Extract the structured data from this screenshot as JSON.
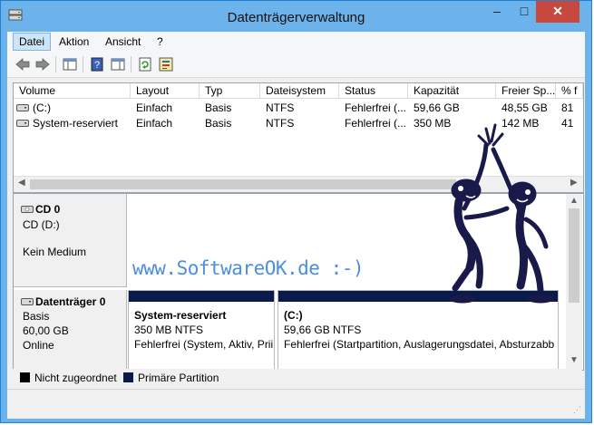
{
  "window": {
    "title": "Datenträgerverwaltung",
    "minimize": "–",
    "maximize": "□",
    "close": "✕"
  },
  "menu": [
    "Datei",
    "Aktion",
    "Ansicht",
    "?"
  ],
  "toolbar": [
    "back-arrow-icon",
    "forward-arrow-icon",
    "console-tree-icon",
    "help-icon",
    "properties-pane-icon",
    "refresh-icon",
    "properties-icon"
  ],
  "columns": [
    "Volume",
    "Layout",
    "Typ",
    "Dateisystem",
    "Status",
    "Kapazität",
    "Freier Sp...",
    "% f"
  ],
  "volumes": [
    {
      "volume": "(C:)",
      "layout": "Einfach",
      "typ": "Basis",
      "fs": "NTFS",
      "status": "Fehlerfrei (...",
      "capacity": "59,66 GB",
      "free": "48,55 GB",
      "pct": "81"
    },
    {
      "volume": "System-reserviert",
      "layout": "Einfach",
      "typ": "Basis",
      "fs": "NTFS",
      "status": "Fehlerfrei (...",
      "capacity": "350 MB",
      "free": "142 MB",
      "pct": "41"
    }
  ],
  "cd": {
    "name": "CD 0",
    "type": "CD (D:)",
    "media": "Kein Medium"
  },
  "disk0": {
    "name": "Datenträger 0",
    "type": "Basis",
    "size": "60,00 GB",
    "state": "Online"
  },
  "partitions": [
    {
      "name": "System-reserviert",
      "size": "350 MB NTFS",
      "status": "Fehlerfrei (System, Aktiv, Prii"
    },
    {
      "name": "(C:)",
      "size": "59,66 GB NTFS",
      "status": "Fehlerfrei (Startpartition, Auslagerungsdatei, Absturzabb"
    }
  ],
  "legend": [
    {
      "label": "Nicht zugeordnet",
      "color": "#000000"
    },
    {
      "label": "Primäre Partition",
      "color": "#0a1a4a"
    }
  ],
  "watermark": "www.SoftwareOK.de :-)",
  "colors": {
    "titlebar": "#6cb3ec",
    "close": "#c7493d",
    "partition_bar": "#0a1a4a",
    "watermark": "#4a8fe0"
  }
}
